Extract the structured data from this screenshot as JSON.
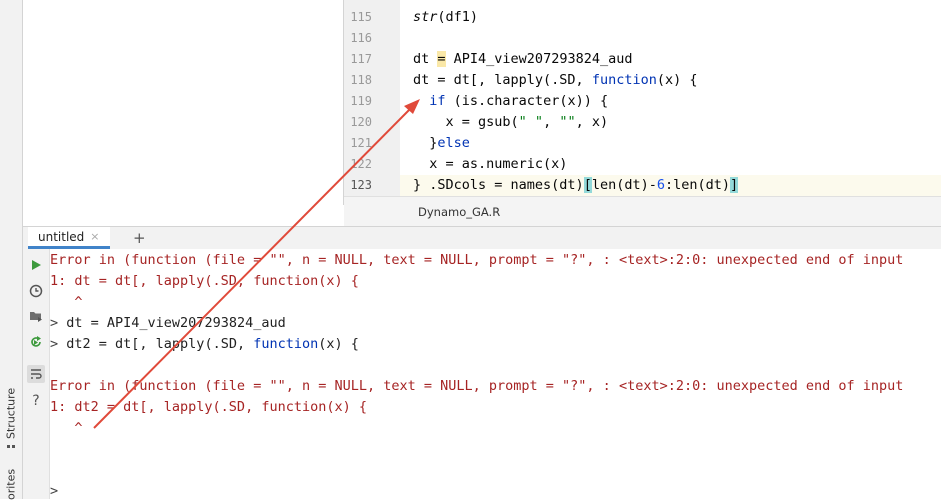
{
  "left_strip": {
    "structure_label": "Structure",
    "favorites_label": "orites"
  },
  "editor": {
    "line_numbers": [
      "115",
      "116",
      "117",
      "118",
      "119",
      "120",
      "121",
      "122",
      "123"
    ],
    "lines": {
      "l115_fn": "str",
      "l115_rest": "(df1)",
      "l117_a": "dt ",
      "l117_eq": "=",
      "l117_b": " API4_view207293824_aud",
      "l118_a": "dt = dt[, lapply(.SD, ",
      "l118_kw": "function",
      "l118_b": "(x) {",
      "l119_indent": "  ",
      "l119_kw": "if",
      "l119_b": " (is.character(x)) {",
      "l120": "    x = gsub(",
      "l120_s1": "\" \"",
      "l120_mid": ", ",
      "l120_s2": "\"\"",
      "l120_end": ", x)",
      "l121_a": "  }",
      "l121_kw": "else",
      "l122": "  x = as.numeric(x)",
      "l123_a": "} .SDcols = names(dt)",
      "l123_br1": "[",
      "l123_b": "len(dt)-",
      "l123_num": "6",
      "l123_c": ":len(dt)",
      "l123_br2": "]"
    },
    "file_tab": "Dynamo_GA.R"
  },
  "console": {
    "tab_label": "untitled",
    "tab_close": "×",
    "add_tab": "+",
    "lines": {
      "e1": "Error in (function (file = \"\", n = NULL, text = NULL, prompt = \"?\", : <text>:2:0: unexpected end of input",
      "e1b": "1: dt = dt[, lapply(.SD, function(x) {",
      "e1c": "   ^",
      "p1": ">",
      "c1": " dt = API4_view207293824_aud",
      "p2": ">",
      "c2a": " dt2 = dt[, lapply(.SD, ",
      "c2kw": "function",
      "c2b": "(x) {",
      "e2": "Error in (function (file = \"\", n = NULL, text = NULL, prompt = \"?\", : <text>:2:0: unexpected end of input",
      "e2b": "1: dt2 = dt[, lapply(.SD, function(x) {",
      "e2c": "   ^",
      "p3": ">"
    }
  },
  "colors": {
    "error_text": "#a62424",
    "keyword": "#0033b3",
    "string": "#067d17",
    "annotation_arrow": "#e04a3a",
    "run_icon": "#3d9a3d"
  }
}
